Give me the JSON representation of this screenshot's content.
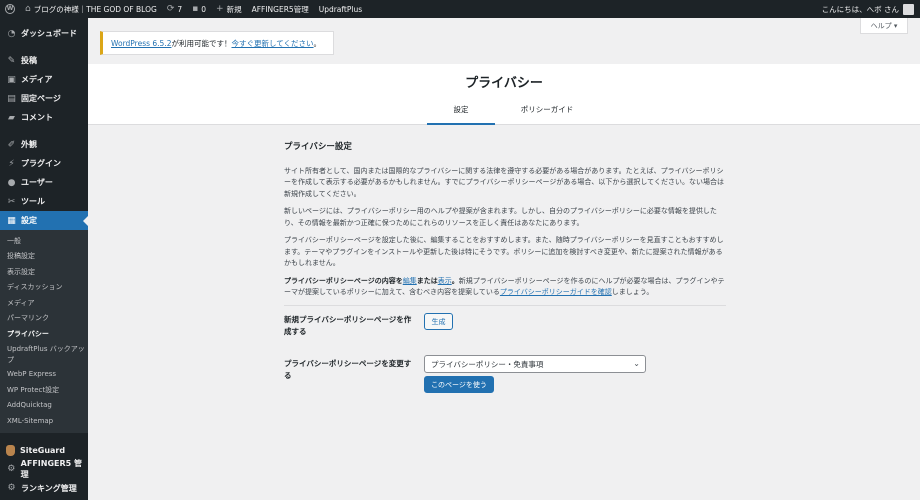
{
  "adminbar": {
    "site_name": "ブログの神様｜THE GOD OF BLOG",
    "updates_count": "7",
    "comments_count": "0",
    "new_label": "新規",
    "affinger_label": "AFFINGER5管理",
    "updraft_label": "UpdraftPlus",
    "greeting": "こんにちは、へボ さん"
  },
  "sidebar": {
    "top_items": [
      {
        "label": "ダッシュボード",
        "icon": "dashboard-icon"
      }
    ],
    "content_items": [
      {
        "label": "投稿",
        "icon": "pin-icon"
      },
      {
        "label": "メディア",
        "icon": "media-icon"
      },
      {
        "label": "固定ページ",
        "icon": "page-icon"
      },
      {
        "label": "コメント",
        "icon": "comment-icon"
      }
    ],
    "config_items": [
      {
        "label": "外観",
        "icon": "brush-icon"
      },
      {
        "label": "プラグイン",
        "icon": "plugin-icon"
      },
      {
        "label": "ユーザー",
        "icon": "user-icon"
      },
      {
        "label": "ツール",
        "icon": "wrench-icon"
      }
    ],
    "settings_label": "設定",
    "submenu": [
      "一般",
      "投稿設定",
      "表示設定",
      "ディスカッション",
      "メディア",
      "パーマリンク",
      "プライバシー",
      "UpdraftPlus バックアップ",
      "WebP Express",
      "WP Protect設定",
      "AddQuicktag",
      "XML-Sitemap"
    ],
    "bottom_items": [
      {
        "label": "SiteGuard",
        "icon": "siteguard-icon"
      },
      {
        "label": "AFFINGER5 管理",
        "icon": "gear-icon"
      },
      {
        "label": "ランキング管理",
        "icon": "gear-icon"
      }
    ]
  },
  "help_label": "ヘルプ ▾",
  "notice": {
    "version_link": "WordPress 6.5.2",
    "middle_text": " が利用可能です！",
    "update_link": "今すぐ更新してください",
    "end_text": "。"
  },
  "header": {
    "title": "プライバシー",
    "tabs": [
      "設定",
      "ポリシーガイド"
    ]
  },
  "content": {
    "heading": "プライバシー設定",
    "p1": "サイト所有者として、国内または国際的なプライバシーに関する法律を遵守する必要がある場合があります。たとえば、プライバシーポリシーを作成して表示する必要があるかもしれません。すでにプライバシーポリシーページがある場合、以下から選択してください。ない場合は新規作成してください。",
    "p2": "新しいページには、プライバシーポリシー用のヘルプや提案が含まれます。しかし、自分のプライバシーポリシーに必要な情報を提供したり、その情報を最新かつ正確に保つためにこれらのリソースを正しく責任はあなたにあります。",
    "p3": "プライバシーポリシーページを設定した後に、編集することをおすすめします。また、随時プライバシーポリシーを見直すこともおすすめします。テーマやプラグインをインストールや更新した後は特にそうです。ポリシーに追加を検討すべき変更や、新たに提案された情報があるかもしれません。",
    "p4_strong": "プライバシーポリシーページの内容を",
    "p4_edit_link": "編集",
    "p4_or": "または",
    "p4_view_link": "表示",
    "p4_strong_end": "。",
    "p4_rest": "新規プライバシーポリシーページを作るのにヘルプが必要な場合は、プラグインやテーマが提案しているポリシーに加えて、含むべき内容を提案している",
    "p4_guide_link": "プライバシーポリシーガイドを確認",
    "p4_end": "しましょう。"
  },
  "form": {
    "create_label": "新規プライバシーポリシーページを作成する",
    "create_button": "生成",
    "change_label": "プライバシーポリシーページを変更する",
    "select_value": "プライバシーポリシー・免責事項",
    "use_button": "このページを使う"
  },
  "colors": {
    "accent": "#2271b1",
    "adminbar": "#1d2327",
    "notice_border": "#dba617"
  }
}
